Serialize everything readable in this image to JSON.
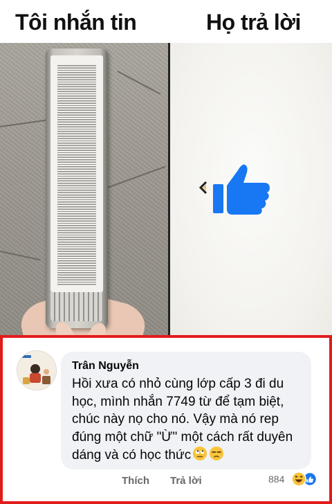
{
  "meme": {
    "left_title": "Tôi nhắn tin",
    "right_title": "Họ trả lời",
    "left_panel_image": "phone-with-very-long-text-message",
    "right_panel_icon": "thumbs-up-icon",
    "like_color": "#1877f2"
  },
  "comment": {
    "author": "Trân Nguyễn",
    "text": "Hồi xưa có nhỏ cùng lớp cấp 3 đi du học, mình nhắn 7749 từ để tạm biệt, chúc này nọ cho nó. Vậy mà nó rep đúng một chữ \"Ừ\" một cách rất duyên dáng và có học thức",
    "emojis": [
      "face-with-rolling-eyes-icon",
      "unamused-face-icon"
    ],
    "actions": {
      "like_label": "Thích",
      "reply_label": "Trả lời"
    },
    "reaction_count": "884",
    "reaction_icons": [
      "haha-icon",
      "like-icon"
    ]
  },
  "colors": {
    "frame_border": "#e21b1b",
    "bubble_bg": "#f0f2f5",
    "muted_text": "#65676b"
  }
}
